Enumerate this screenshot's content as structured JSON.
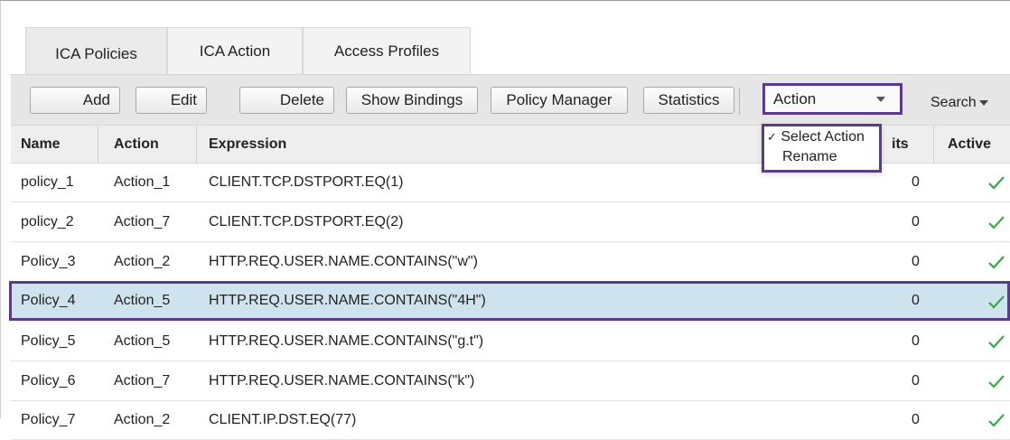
{
  "tabs": [
    {
      "label": "ICA Policies",
      "active": true
    },
    {
      "label": "ICA Action",
      "active": false
    },
    {
      "label": "Access Profiles",
      "active": false
    }
  ],
  "toolbar": {
    "add_label": "Add",
    "edit_label": "Edit",
    "delete_label": "Delete",
    "show_bindings_label": "Show Bindings",
    "policy_manager_label": "Policy Manager",
    "statistics_label": "Statistics",
    "action_select_value": "Action",
    "search_label": "Search"
  },
  "action_dropdown": {
    "options": [
      {
        "label": "Select Action",
        "checked": true,
        "mark": "✓"
      },
      {
        "label": "Rename",
        "checked": false
      }
    ]
  },
  "table": {
    "columns": [
      "Name",
      "Action",
      "Expression",
      "its",
      "Active"
    ],
    "rows": [
      {
        "name": "policy_1",
        "action": "Action_1",
        "expression": "CLIENT.TCP.DSTPORT.EQ(1)",
        "hits": "0",
        "active": true,
        "selected": false
      },
      {
        "name": "policy_2",
        "action": "Action_7",
        "expression": "CLIENT.TCP.DSTPORT.EQ(2)",
        "hits": "0",
        "active": true,
        "selected": false
      },
      {
        "name": "Policy_3",
        "action": "Action_2",
        "expression": "HTTP.REQ.USER.NAME.CONTAINS(\"w\")",
        "hits": "0",
        "active": true,
        "selected": false
      },
      {
        "name": "Policy_4",
        "action": "Action_5",
        "expression": "HTTP.REQ.USER.NAME.CONTAINS(\"4H\")",
        "hits": "0",
        "active": true,
        "selected": true
      },
      {
        "name": "Policy_5",
        "action": "Action_5",
        "expression": "HTTP.REQ.USER.NAME.CONTAINS(\"g.t\")",
        "hits": "0",
        "active": true,
        "selected": false
      },
      {
        "name": "Policy_6",
        "action": "Action_7",
        "expression": "HTTP.REQ.USER.NAME.CONTAINS(\"k\")",
        "hits": "0",
        "active": true,
        "selected": false
      },
      {
        "name": "Policy_7",
        "action": "Action_2",
        "expression": "CLIENT.IP.DST.EQ(77)",
        "hits": "0",
        "active": true,
        "selected": false
      }
    ]
  },
  "icons": {
    "active": "check-icon",
    "dropdown_arrow": "chevron-down-icon"
  },
  "colors": {
    "highlight_border": "#5b3a8a",
    "selected_row": "#cfe3ee",
    "check": "#3aa84a",
    "toolbar_bg": "#e6e6e6"
  }
}
